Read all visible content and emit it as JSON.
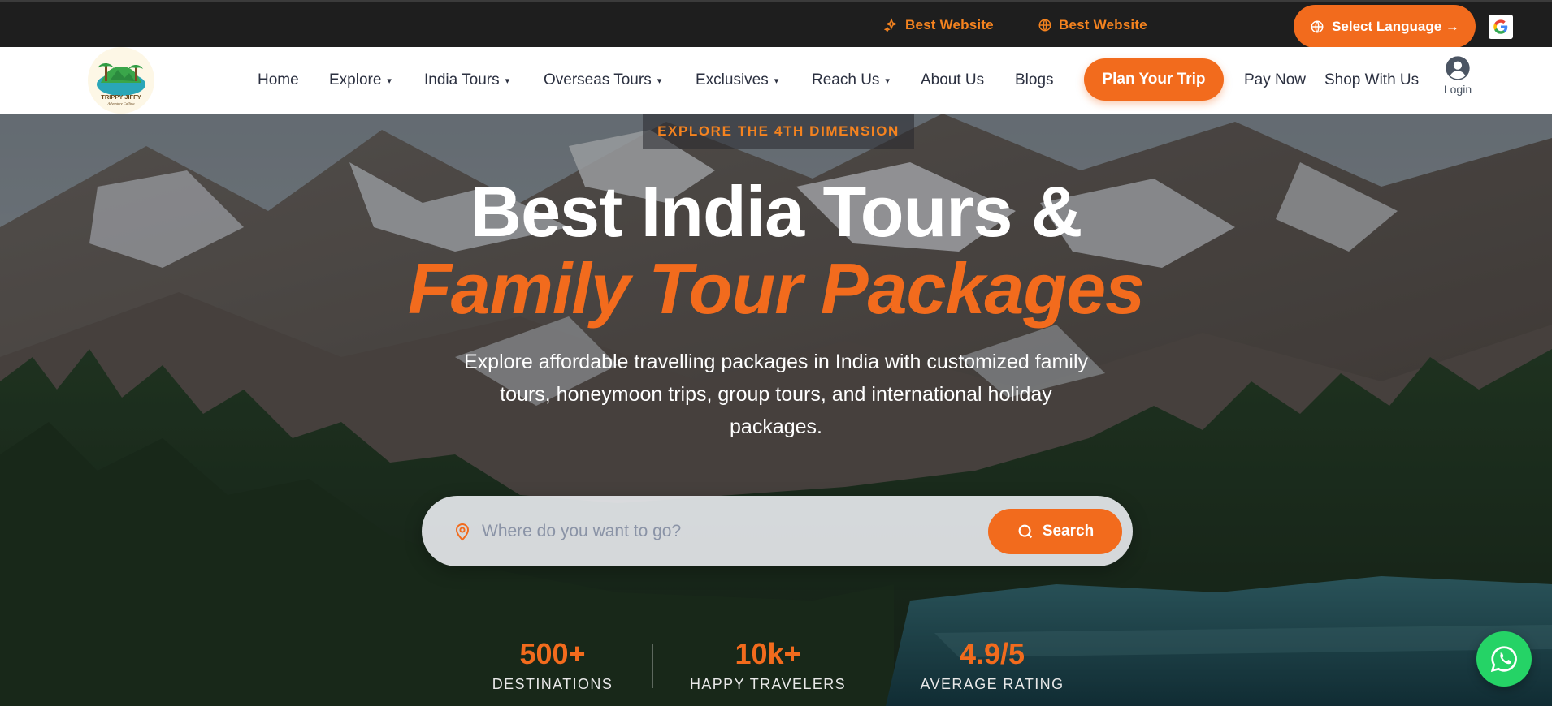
{
  "topbar": {
    "link1": "Best Website",
    "link1_icon": "sparkle-icon",
    "link2": "Best Website",
    "link2_icon": "globe-icon",
    "language_button": "Select Language →",
    "google_translate_icon": "google-icon"
  },
  "nav": {
    "logo_icon": "trippy-jiffy-logo",
    "items": [
      {
        "label": "Home",
        "dropdown": false
      },
      {
        "label": "Explore",
        "dropdown": true
      },
      {
        "label": "India Tours",
        "dropdown": true
      },
      {
        "label": "Overseas Tours",
        "dropdown": true
      },
      {
        "label": "Exclusives",
        "dropdown": true
      },
      {
        "label": "Reach Us",
        "dropdown": true
      },
      {
        "label": "About Us",
        "dropdown": false
      },
      {
        "label": "Blogs",
        "dropdown": false
      }
    ],
    "caret": "▾",
    "plan_button": "Plan Your Trip",
    "pay_now": "Pay Now",
    "shop": "Shop With Us",
    "login": "Login"
  },
  "hero": {
    "eyebrow": "EXPLORE THE 4TH DIMENSION",
    "title_line1": "Best India Tours &",
    "title_line2": "Family Tour Packages",
    "subtitle": "Explore affordable travelling packages in India with customized family tours, honeymoon trips, group tours, and international holiday packages.",
    "search": {
      "placeholder": "Where do you want to go?",
      "value": "",
      "button": "Search"
    },
    "stats": [
      {
        "value": "500+",
        "label": "DESTINATIONS"
      },
      {
        "value": "10k+",
        "label": "HAPPY TRAVELERS"
      },
      {
        "value": "4.9/5",
        "label": "AVERAGE RATING"
      }
    ]
  },
  "colors": {
    "accent": "#f26b1d",
    "topbar_bg": "#1e1e1e",
    "whatsapp": "#25d366"
  }
}
